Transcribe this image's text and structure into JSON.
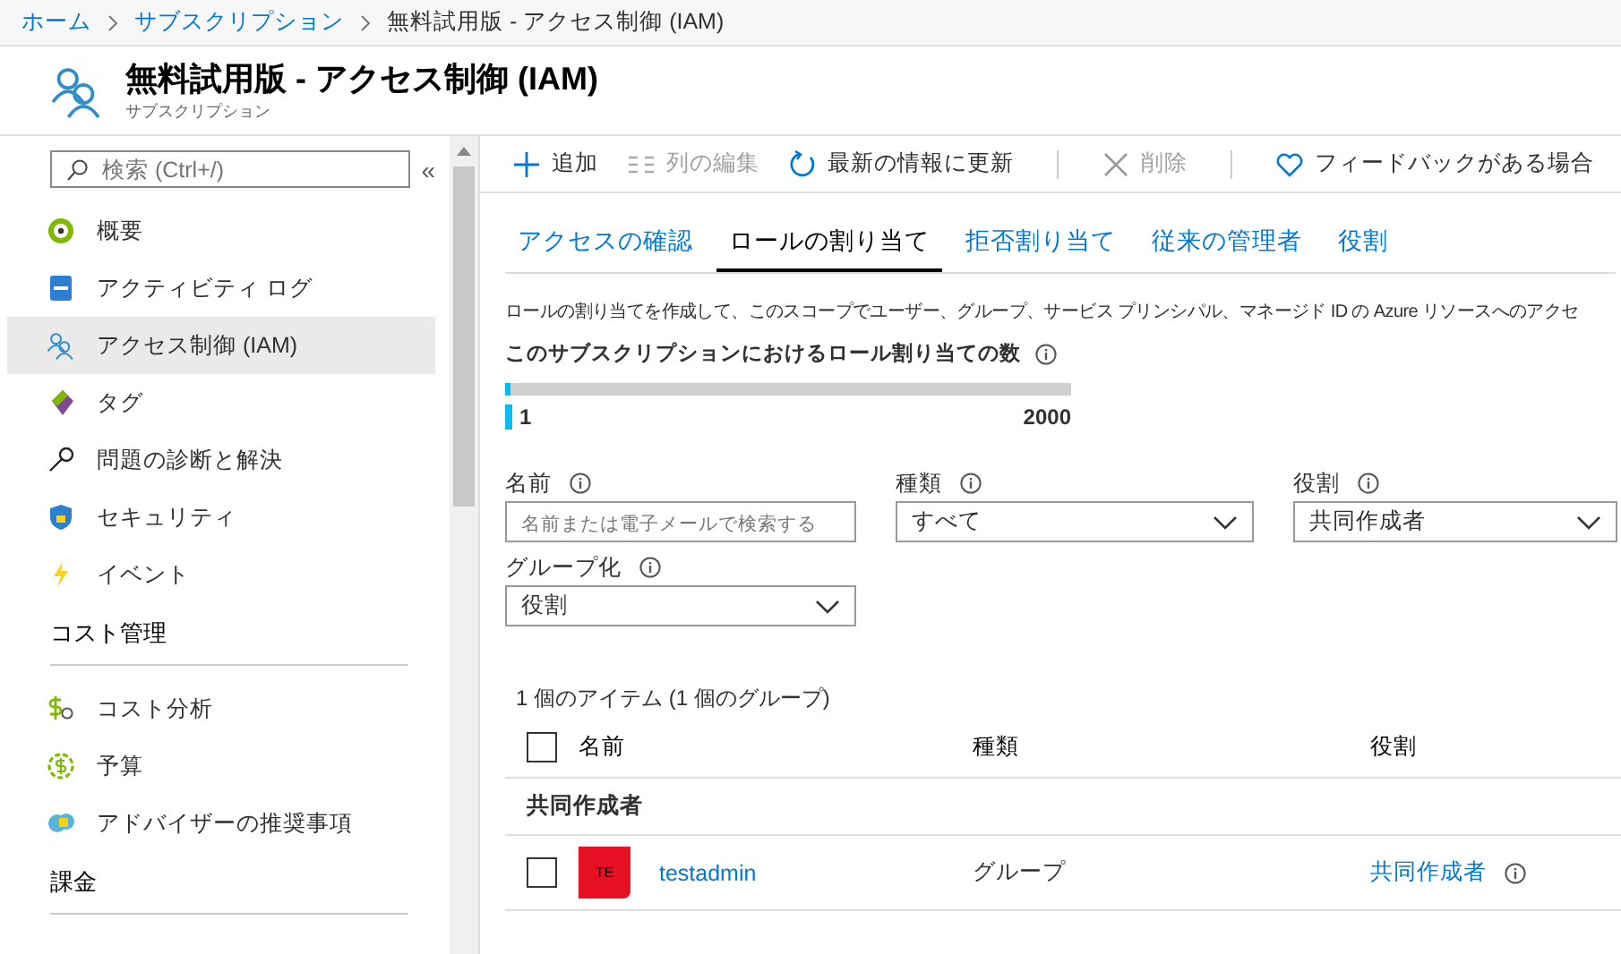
{
  "breadcrumb": [
    {
      "label": "ホーム",
      "link": true
    },
    {
      "label": "サブスクリプション",
      "link": true
    },
    {
      "label": "無料試用版 - アクセス制御 (IAM)",
      "link": false
    }
  ],
  "header": {
    "title": "無料試用版 - アクセス制御 (IAM)",
    "subtitle": "サブスクリプション"
  },
  "sidebar": {
    "search": {
      "placeholder": "検索 (Ctrl+/)"
    },
    "collapse": "«",
    "sections": [
      {
        "items": [
          {
            "label": "概要",
            "selected": false
          },
          {
            "label": "アクティビティ ログ",
            "selected": false
          },
          {
            "label": "アクセス制御 (IAM)",
            "selected": true
          },
          {
            "label": "タグ",
            "selected": false
          },
          {
            "label": "問題の診断と解決",
            "selected": false
          },
          {
            "label": "セキュリティ",
            "selected": false
          },
          {
            "label": "イベント",
            "selected": false
          }
        ]
      },
      {
        "title": "コスト管理",
        "items": [
          {
            "label": "コスト分析",
            "selected": false
          },
          {
            "label": "予算",
            "selected": false
          },
          {
            "label": "アドバイザーの推奨事項",
            "selected": false
          }
        ]
      },
      {
        "title": "課金"
      }
    ]
  },
  "toolbar": [
    {
      "label": "追加",
      "disabled": false
    },
    {
      "label": "列の編集",
      "disabled": true
    },
    {
      "label": "最新の情報に更新",
      "disabled": false
    },
    {
      "label": "削除",
      "disabled": true
    },
    {
      "label": "フィードバックがある場合",
      "disabled": false
    }
  ],
  "tabs": [
    {
      "label": "アクセスの確認",
      "selected": false
    },
    {
      "label": "ロールの割り当て",
      "selected": true
    },
    {
      "label": "拒否割り当て",
      "selected": false
    },
    {
      "label": "従来の管理者",
      "selected": false
    },
    {
      "label": "役割",
      "selected": false
    }
  ],
  "description": "ロールの割り当てを作成して、このスコープでユーザー、グループ、サービス プリンシパル、マネージド ID の Azure リソースへのアクセ",
  "quota": {
    "label": "このサブスクリプションにおけるロール割り当ての数",
    "level": 0.0005,
    "current": "1",
    "max": "2000"
  },
  "filters": [
    {
      "kind": "text",
      "label": "名前",
      "placeholder": "名前または電子メールで検索する"
    },
    {
      "kind": "select",
      "label": "種類",
      "value": "すべて"
    },
    {
      "kind": "select",
      "label": "役割",
      "value": "共同作成者"
    },
    {
      "kind": "select",
      "label": "グループ化",
      "value": "役割"
    }
  ],
  "table": {
    "all_checked": false,
    "summary": "1 個のアイテム (1 個のグループ)",
    "columns": [
      "名前",
      "種類",
      "役割"
    ],
    "groups": [
      {
        "title": "共同作成者",
        "rows": [
          {
            "checked": false,
            "avatar": "TE",
            "color": "#e81123",
            "name": "testadmin",
            "type": "グループ",
            "role": "共同作成者"
          }
        ]
      }
    ]
  }
}
